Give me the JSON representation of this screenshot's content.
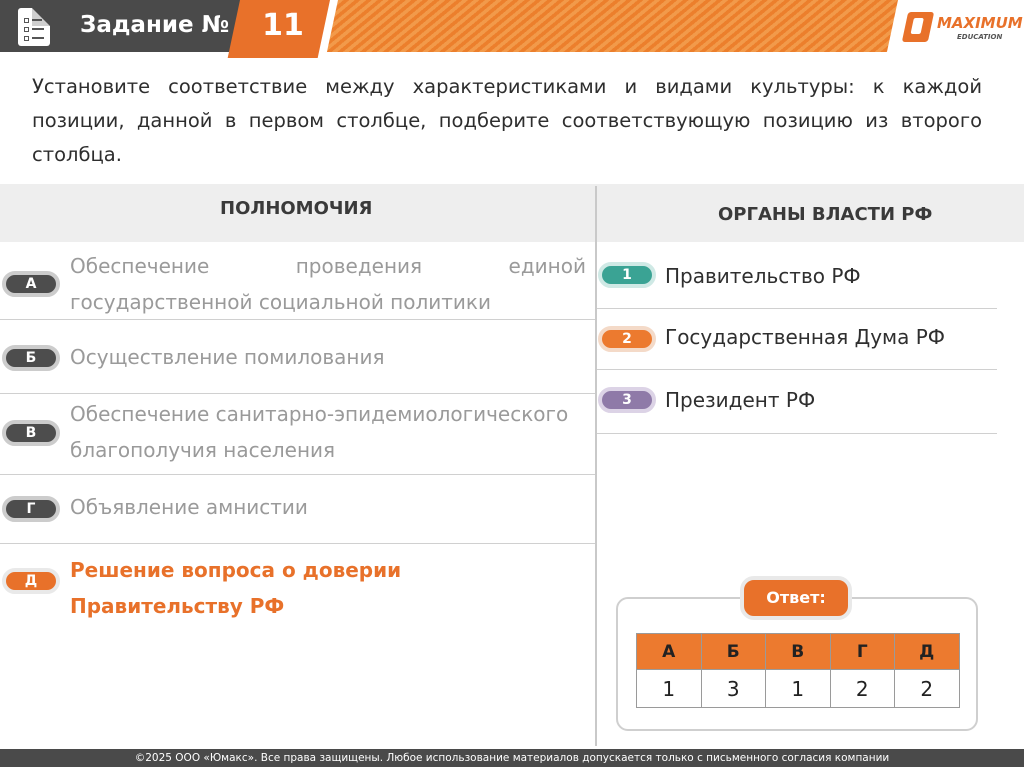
{
  "header": {
    "title": "Задание №",
    "number": "11",
    "logo_text": "MAXIMUM",
    "logo_sub": "EDUCATION"
  },
  "task_text": "Установите соответствие между характеристиками и видами культуры: к каждой позиции, данной в первом столбце, подберите соответствующую позицию из второго столбца.",
  "left_column": {
    "heading": "ПОЛНОМОЧИЯ",
    "items": [
      {
        "letter": "А",
        "text": "Обеспечение проведения единой государственной социальной политики"
      },
      {
        "letter": "Б",
        "text": "Осуществление помилования"
      },
      {
        "letter": "В",
        "text": "Обеспечение санитарно-эпидемиологического благополучия населения"
      },
      {
        "letter": "Г",
        "text": "Объявление амнистии"
      },
      {
        "letter": "Д",
        "text": "Решение вопроса о доверии Правительству РФ"
      }
    ]
  },
  "right_column": {
    "heading": "ОРГАНЫ ВЛАСТИ РФ",
    "items": [
      {
        "number": "1",
        "text": "Правительство РФ",
        "color": "#3aa394"
      },
      {
        "number": "2",
        "text": "Государственная Дума РФ",
        "color": "#ec7a2f"
      },
      {
        "number": "3",
        "text": "Президент РФ",
        "color": "#8f7aa8"
      }
    ]
  },
  "answer": {
    "label": "Ответ:",
    "headers": [
      "А",
      "Б",
      "В",
      "Г",
      "Д"
    ],
    "values": [
      "1",
      "3",
      "1",
      "2",
      "2"
    ]
  },
  "footer": "©2025 ООО «Юмакс». Все права защищены. Любое использование материалов допускается только с  письменного согласия компании",
  "colors": {
    "accent": "#e8712a",
    "header_gray": "#4a4a4a"
  }
}
